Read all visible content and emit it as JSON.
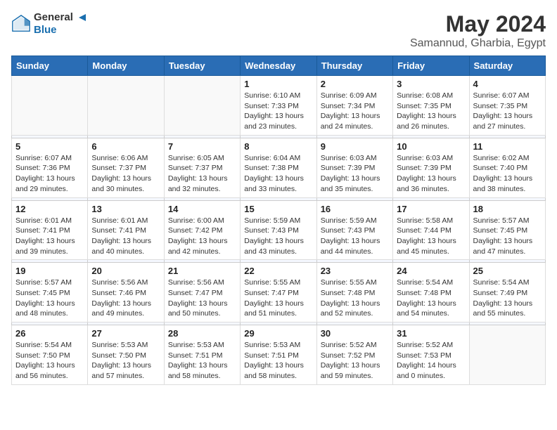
{
  "logo": {
    "text_general": "General",
    "text_blue": "Blue"
  },
  "title": "May 2024",
  "location": "Samannud, Gharbia, Egypt",
  "weekdays": [
    "Sunday",
    "Monday",
    "Tuesday",
    "Wednesday",
    "Thursday",
    "Friday",
    "Saturday"
  ],
  "weeks": [
    {
      "days": [
        {
          "date": "",
          "info": ""
        },
        {
          "date": "",
          "info": ""
        },
        {
          "date": "",
          "info": ""
        },
        {
          "date": "1",
          "sunrise": "6:10 AM",
          "sunset": "7:33 PM",
          "daylight": "13 hours and 23 minutes."
        },
        {
          "date": "2",
          "sunrise": "6:09 AM",
          "sunset": "7:34 PM",
          "daylight": "13 hours and 24 minutes."
        },
        {
          "date": "3",
          "sunrise": "6:08 AM",
          "sunset": "7:35 PM",
          "daylight": "13 hours and 26 minutes."
        },
        {
          "date": "4",
          "sunrise": "6:07 AM",
          "sunset": "7:35 PM",
          "daylight": "13 hours and 27 minutes."
        }
      ]
    },
    {
      "days": [
        {
          "date": "5",
          "sunrise": "6:07 AM",
          "sunset": "7:36 PM",
          "daylight": "13 hours and 29 minutes."
        },
        {
          "date": "6",
          "sunrise": "6:06 AM",
          "sunset": "7:37 PM",
          "daylight": "13 hours and 30 minutes."
        },
        {
          "date": "7",
          "sunrise": "6:05 AM",
          "sunset": "7:37 PM",
          "daylight": "13 hours and 32 minutes."
        },
        {
          "date": "8",
          "sunrise": "6:04 AM",
          "sunset": "7:38 PM",
          "daylight": "13 hours and 33 minutes."
        },
        {
          "date": "9",
          "sunrise": "6:03 AM",
          "sunset": "7:39 PM",
          "daylight": "13 hours and 35 minutes."
        },
        {
          "date": "10",
          "sunrise": "6:03 AM",
          "sunset": "7:39 PM",
          "daylight": "13 hours and 36 minutes."
        },
        {
          "date": "11",
          "sunrise": "6:02 AM",
          "sunset": "7:40 PM",
          "daylight": "13 hours and 38 minutes."
        }
      ]
    },
    {
      "days": [
        {
          "date": "12",
          "sunrise": "6:01 AM",
          "sunset": "7:41 PM",
          "daylight": "13 hours and 39 minutes."
        },
        {
          "date": "13",
          "sunrise": "6:01 AM",
          "sunset": "7:41 PM",
          "daylight": "13 hours and 40 minutes."
        },
        {
          "date": "14",
          "sunrise": "6:00 AM",
          "sunset": "7:42 PM",
          "daylight": "13 hours and 42 minutes."
        },
        {
          "date": "15",
          "sunrise": "5:59 AM",
          "sunset": "7:43 PM",
          "daylight": "13 hours and 43 minutes."
        },
        {
          "date": "16",
          "sunrise": "5:59 AM",
          "sunset": "7:43 PM",
          "daylight": "13 hours and 44 minutes."
        },
        {
          "date": "17",
          "sunrise": "5:58 AM",
          "sunset": "7:44 PM",
          "daylight": "13 hours and 45 minutes."
        },
        {
          "date": "18",
          "sunrise": "5:57 AM",
          "sunset": "7:45 PM",
          "daylight": "13 hours and 47 minutes."
        }
      ]
    },
    {
      "days": [
        {
          "date": "19",
          "sunrise": "5:57 AM",
          "sunset": "7:45 PM",
          "daylight": "13 hours and 48 minutes."
        },
        {
          "date": "20",
          "sunrise": "5:56 AM",
          "sunset": "7:46 PM",
          "daylight": "13 hours and 49 minutes."
        },
        {
          "date": "21",
          "sunrise": "5:56 AM",
          "sunset": "7:47 PM",
          "daylight": "13 hours and 50 minutes."
        },
        {
          "date": "22",
          "sunrise": "5:55 AM",
          "sunset": "7:47 PM",
          "daylight": "13 hours and 51 minutes."
        },
        {
          "date": "23",
          "sunrise": "5:55 AM",
          "sunset": "7:48 PM",
          "daylight": "13 hours and 52 minutes."
        },
        {
          "date": "24",
          "sunrise": "5:54 AM",
          "sunset": "7:48 PM",
          "daylight": "13 hours and 54 minutes."
        },
        {
          "date": "25",
          "sunrise": "5:54 AM",
          "sunset": "7:49 PM",
          "daylight": "13 hours and 55 minutes."
        }
      ]
    },
    {
      "days": [
        {
          "date": "26",
          "sunrise": "5:54 AM",
          "sunset": "7:50 PM",
          "daylight": "13 hours and 56 minutes."
        },
        {
          "date": "27",
          "sunrise": "5:53 AM",
          "sunset": "7:50 PM",
          "daylight": "13 hours and 57 minutes."
        },
        {
          "date": "28",
          "sunrise": "5:53 AM",
          "sunset": "7:51 PM",
          "daylight": "13 hours and 58 minutes."
        },
        {
          "date": "29",
          "sunrise": "5:53 AM",
          "sunset": "7:51 PM",
          "daylight": "13 hours and 58 minutes."
        },
        {
          "date": "30",
          "sunrise": "5:52 AM",
          "sunset": "7:52 PM",
          "daylight": "13 hours and 59 minutes."
        },
        {
          "date": "31",
          "sunrise": "5:52 AM",
          "sunset": "7:53 PM",
          "daylight": "14 hours and 0 minutes."
        },
        {
          "date": "",
          "info": ""
        }
      ]
    }
  ],
  "labels": {
    "sunrise": "Sunrise:",
    "sunset": "Sunset:",
    "daylight": "Daylight:"
  }
}
